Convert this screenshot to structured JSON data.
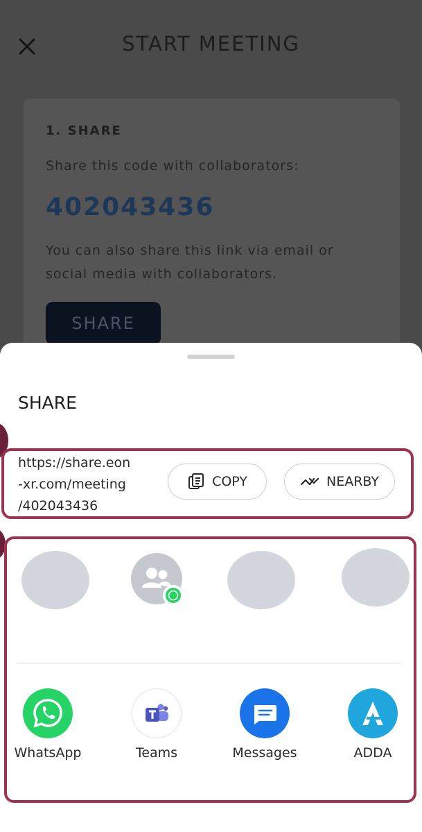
{
  "background": {
    "page_title": "START MEETING",
    "card": {
      "step_title": "1. SHARE",
      "share_hint": "Share this code with collaborators:",
      "meeting_code": "402043436",
      "link_hint": "You can also share this link via email or social media with collaborators.",
      "share_button": "SHARE"
    }
  },
  "sheet": {
    "title": "SHARE",
    "link": {
      "line1": "https://share.eon",
      "line2": "-xr.com/meeting",
      "line3": "/402043436"
    },
    "copy_label": "COPY",
    "nearby_label": "NEARBY",
    "apps": [
      {
        "label": "WhatsApp",
        "icon": "whatsapp-icon",
        "color": "#25d366"
      },
      {
        "label": "Teams",
        "icon": "teams-icon",
        "color": "#5b5fc7"
      },
      {
        "label": "Messages",
        "icon": "messages-icon",
        "color": "#1a73e8"
      },
      {
        "label": "ADDA",
        "icon": "adda-icon",
        "color": "#1fa7dd"
      }
    ]
  },
  "colors": {
    "highlight": "#9e3350",
    "overlay": "#4a4a4a"
  }
}
